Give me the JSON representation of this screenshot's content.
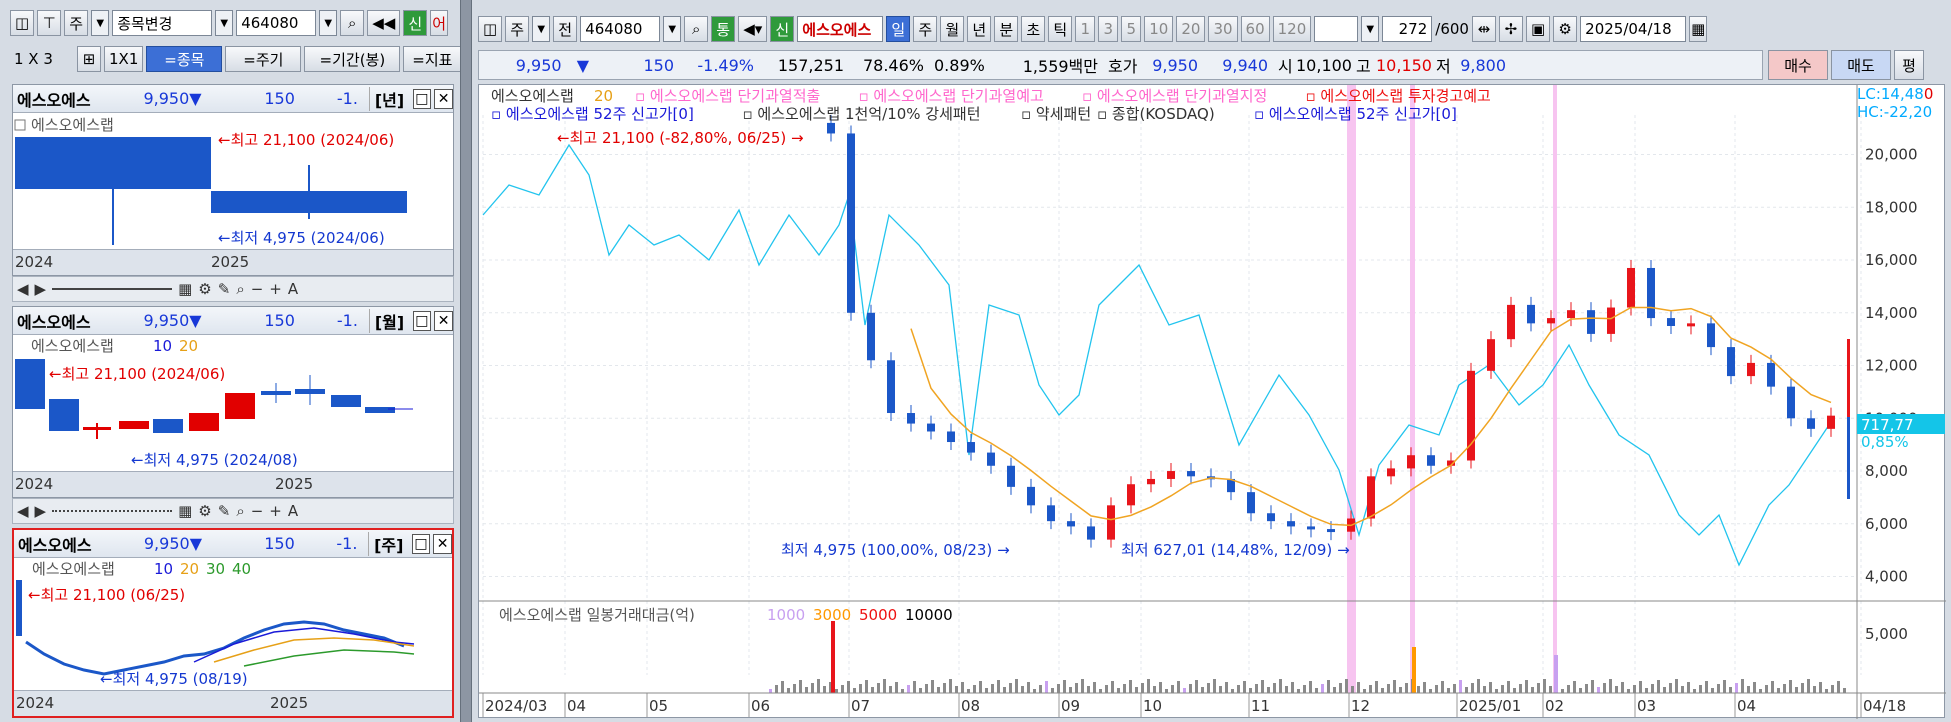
{
  "left_toolbar": {
    "period": "주",
    "change_label": "종목변경",
    "code": "464080",
    "signal": "신",
    "alert": "어"
  },
  "left_toolbar2": {
    "layout": "1 X 3",
    "one": "1X1",
    "tabs": [
      "=종목",
      "=주기",
      "=기간(봉)",
      "=지표"
    ]
  },
  "stock": {
    "name": "에스오에스",
    "full": "에스오에스랩",
    "price": "9,950",
    "arrow": "▼",
    "change": "150",
    "rate": "-1.",
    "rate_full": "-1.49%",
    "vol": "157,251",
    "vol_pct": "78.46%",
    "turn": "0.89%",
    "amount": "1,559백만",
    "hoga": "호가",
    "ask": "9,950",
    "bid": "9,940",
    "open_lbl": "시",
    "open": "10,100",
    "high_lbl": "고",
    "high": "10,150",
    "low_lbl": "저",
    "low": "9,800"
  },
  "mini_year": {
    "period": "[년]",
    "legend": "에스오에스랩",
    "max": "최고 21,100 (2024/06)",
    "min": "최저 4,975 (2024/06)",
    "axis": [
      "2024",
      "2025"
    ]
  },
  "mini_month": {
    "period": "[월]",
    "legend": "에스오에스랩",
    "ma": [
      "10",
      "20"
    ],
    "max": "최고 21,100 (2024/06)",
    "min": "최저 4,975 (2024/08)",
    "axis": [
      "2024",
      "2025"
    ]
  },
  "mini_week": {
    "period": "[주]",
    "legend": "에스오에스랩",
    "ma": [
      "10",
      "20",
      "30",
      "40"
    ],
    "max": "최고 21,100 (06/25)",
    "min": "최저 4,975 (08/19)",
    "axis": [
      "2024",
      "2025"
    ]
  },
  "main_toolbar": {
    "period": "주",
    "prev": "전",
    "code": "464080",
    "tong": "통",
    "sin": "신",
    "name": "에스오에스",
    "periods": [
      "일",
      "주",
      "월",
      "년",
      "분",
      "초",
      "틱"
    ],
    "nums": [
      "1",
      "3",
      "5",
      "10",
      "20",
      "30",
      "60",
      "120"
    ],
    "count": "272",
    "total": "/600",
    "date": "2025/04/18"
  },
  "actions": {
    "buy": "매수",
    "sell": "매도",
    "avg": "평"
  },
  "legend1": [
    {
      "text": "에스오에스랩",
      "color": "#333333"
    },
    {
      "text": "20",
      "color": "#e6a017"
    },
    {
      "text": "에스오에스랩 단기과열적출",
      "color": "#ff66cc"
    },
    {
      "text": "에스오에스랩 단기과열예고",
      "color": "#ff66cc"
    },
    {
      "text": "에스오에스랩 단기과열지정",
      "color": "#ff66cc"
    },
    {
      "text": "에스오에스랩 투자경고예고",
      "color": "#ee1111"
    }
  ],
  "legend2": [
    {
      "text": "에스오에스랩 52주 신고가[0]",
      "color": "#1a1ad8"
    },
    {
      "text": "에스오에스랩 1천억/10% 강세패턴",
      "color": "#333333"
    },
    {
      "text": "약세패턴",
      "color": "#333333"
    },
    {
      "text": "종합(KOSDAQ)",
      "color": "#333333"
    },
    {
      "text": "에스오에스랩 52주 신고가[0]",
      "color": "#1a1ad8"
    }
  ],
  "corner": {
    "lc": "LC:14,48",
    "lc_red": "0",
    "hc": "HC:-22,20"
  },
  "annotations": {
    "high": "최고 21,100 (-82,80%, 06/25)",
    "low1": "최저 4,975 (100,00%, 08/23)",
    "low2": "최저 627,01 (14,48%, 12/09)"
  },
  "price_tag": {
    "value": "717,77",
    "pct": "0,85%"
  },
  "vol_legend": {
    "title": "에스오에스랩 일봉거래대금(억)",
    "levels": [
      {
        "text": "1000",
        "color": "#c8a0f0"
      },
      {
        "text": "3000",
        "color": "#ff9900"
      },
      {
        "text": "5000",
        "color": "#ee1111"
      },
      {
        "text": "10000",
        "color": "#000000"
      }
    ],
    "axis": "5,000"
  },
  "chart_data": {
    "type": "line",
    "title": "에스오에스랩",
    "x_labels": [
      "2024/03",
      "04",
      "05",
      "06",
      "07",
      "08",
      "09",
      "10",
      "11",
      "12",
      "2025/01",
      "02",
      "03",
      "04",
      "04/18"
    ],
    "y_ticks": [
      "20,000",
      "18,000",
      "16,000",
      "14,000",
      "12,000",
      "10,000",
      "8,000",
      "6,000",
      "4,000"
    ],
    "ylim": [
      3300,
      21500
    ],
    "series": [
      {
        "name": "에스오에스랩",
        "x": [
          "06/25",
          "06/27",
          "07/01",
          "07/05",
          "07/10",
          "07/15",
          "07/20",
          "07/25",
          "08/01",
          "08/07",
          "08/14",
          "08/19",
          "08/23",
          "08/28",
          "09/03",
          "09/09",
          "09/15",
          "09/20",
          "09/27",
          "10/04",
          "10/10",
          "10/17",
          "10/23",
          "10/30",
          "11/05",
          "11/12",
          "11/19",
          "11/26",
          "12/02",
          "12/06",
          "12/11",
          "12/16",
          "12/20",
          "12/26",
          "01/03",
          "01/10",
          "01/16",
          "01/22",
          "01/31",
          "02/06",
          "02/12",
          "02/18",
          "02/24",
          "03/04",
          "03/10",
          "03/17",
          "03/24",
          "03/31",
          "04/07",
          "04/11",
          "04/18"
        ],
        "y": [
          20800,
          14000,
          12200,
          10200,
          9800,
          9500,
          9100,
          8700,
          8200,
          7400,
          6700,
          6100,
          5900,
          5400,
          6700,
          7500,
          7700,
          8000,
          7800,
          7700,
          7200,
          6400,
          6100,
          5900,
          5800,
          5700,
          6200,
          7800,
          8100,
          8600,
          8200,
          8400,
          11800,
          13000,
          14300,
          13600,
          13800,
          14100,
          13200,
          14200,
          15700,
          13800,
          13500,
          13600,
          12700,
          11600,
          12100,
          11200,
          10000,
          9600,
          10100
        ]
      }
    ]
  }
}
